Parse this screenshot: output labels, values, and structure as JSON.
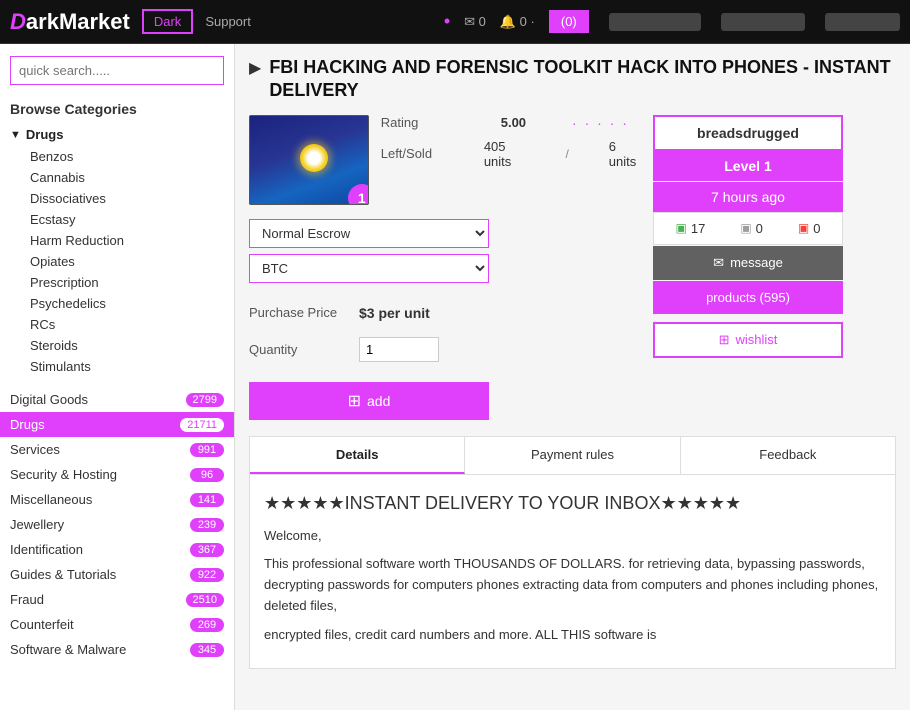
{
  "topnav": {
    "logo": "DarkMarket",
    "dark_btn": "Dark",
    "support_label": "Support",
    "cart_label": "(0)",
    "nav_dot": "•",
    "blurred1": "▓▓▓▓▓▓",
    "blurred2": "▓▓▓▓▓",
    "blurred3": "▓▓▓▓"
  },
  "sidebar": {
    "search_placeholder": "quick search.....",
    "browse_title": "Browse Categories",
    "drugs_label": "Drugs",
    "subcategories": [
      {
        "label": "Benzos"
      },
      {
        "label": "Cannabis"
      },
      {
        "label": "Dissociatives"
      },
      {
        "label": "Ecstasy"
      },
      {
        "label": "Harm Reduction"
      },
      {
        "label": "Opiates"
      },
      {
        "label": "Prescription"
      },
      {
        "label": "Psychedelics"
      },
      {
        "label": "RCs"
      },
      {
        "label": "Steroids"
      },
      {
        "label": "Stimulants"
      }
    ],
    "list_items": [
      {
        "label": "Digital Goods",
        "count": "2799"
      },
      {
        "label": "Drugs",
        "count": "21711",
        "active": true
      },
      {
        "label": "Services",
        "count": "991"
      },
      {
        "label": "Security & Hosting",
        "count": "96"
      },
      {
        "label": "Miscellaneous",
        "count": "141"
      },
      {
        "label": "Jewellery",
        "count": "239"
      },
      {
        "label": "Identification",
        "count": "367"
      },
      {
        "label": "Guides & Tutorials",
        "count": "922"
      },
      {
        "label": "Fraud",
        "count": "2510"
      },
      {
        "label": "Counterfeit",
        "count": "269"
      },
      {
        "label": "Software & Malware",
        "count": "345"
      }
    ]
  },
  "product": {
    "title": "FBI HACKING AND FORENSIC TOOLKIT HACK INTO PHONES - INSTANT DELIVERY",
    "rating_label": "Rating",
    "rating_value": "5.00",
    "rating_dots": "· · · · ·",
    "leftsold_label": "Left/Sold",
    "units_left": "405 units",
    "units_sold": "6 units",
    "escrow_option": "Normal Escrow",
    "currency_option": "BTC",
    "price_label": "Purchase Price",
    "price_value": "$3 per unit",
    "qty_label": "Quantity",
    "qty_value": "1",
    "add_label": "add",
    "thumb_number": "1"
  },
  "seller": {
    "name": "breadsdrugged",
    "level_label": "Level 1",
    "ago_label": "7 hours ago",
    "positive": "17",
    "neutral": "0",
    "negative": "0",
    "message_label": "message",
    "products_label": "products (595)",
    "wishlist_label": "wishlist"
  },
  "tabs": [
    {
      "label": "Details",
      "active": true
    },
    {
      "label": "Payment rules"
    },
    {
      "label": "Feedback"
    }
  ],
  "details": {
    "stars": "★★★★★INSTANT DELIVERY TO YOUR INBOX★★★★★",
    "welcome": "Welcome,",
    "body1": "This professional software worth THOUSANDS OF DOLLARS. for retrieving data, bypassing passwords, decrypting passwords for computers phones extracting data from computers and phones including phones, deleted files,",
    "body2": "encrypted files, credit card numbers and more. ALL THIS software is"
  }
}
